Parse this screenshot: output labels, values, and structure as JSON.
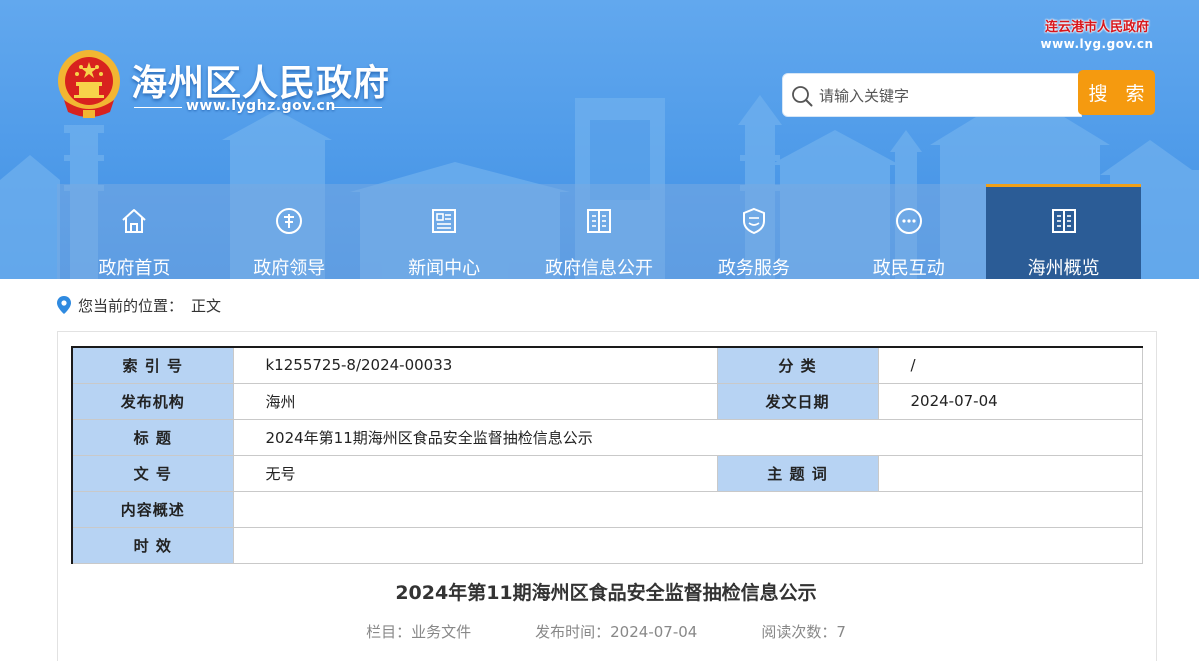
{
  "header": {
    "site_title": "海州区人民政府",
    "site_url": "www.lyghz.gov.cn",
    "city_link": {
      "name": "连云港市人民政府",
      "url": "www.lyg.gov.cn"
    },
    "search": {
      "placeholder": "请输入关键字",
      "button_label": "搜 索"
    },
    "colors": {
      "header_blue": "#4f9be9",
      "search_button": "#f59a0f",
      "nav_active": "#2b5c96",
      "nav_active_top": "#f0a019",
      "city_red": "#d8161b"
    }
  },
  "nav": {
    "items": [
      {
        "label": "政府首页",
        "icon": "home-icon",
        "active": false
      },
      {
        "label": "政府领导",
        "icon": "leader-icon",
        "active": false
      },
      {
        "label": "新闻中心",
        "icon": "news-icon",
        "active": false
      },
      {
        "label": "政府信息公开",
        "icon": "document-icon",
        "active": false
      },
      {
        "label": "政务服务",
        "icon": "shield-icon",
        "active": false
      },
      {
        "label": "政民互动",
        "icon": "chat-bubble-icon",
        "active": false
      },
      {
        "label": "海州概览",
        "icon": "book-icon",
        "active": true
      }
    ]
  },
  "breadcrumb": {
    "prefix": "您当前的位置：",
    "current": "正文"
  },
  "meta": {
    "index_label": "索 引 号",
    "index_value": "k1255725-8/2024-00033",
    "category_label": "分 类",
    "category_value": "/",
    "publisher_label": "发布机构",
    "publisher_value": "海州",
    "date_label": "发文日期",
    "date_value": "2024-07-04",
    "title_label": "标 题",
    "title_value": "2024年第11期海州区食品安全监督抽检信息公示",
    "docno_label": "文 号",
    "docno_value": "无号",
    "keywords_label": "主 题 词",
    "keywords_value": "",
    "summary_label": "内容概述",
    "summary_value": "",
    "validity_label": "时 效",
    "validity_value": ""
  },
  "article": {
    "title": "2024年第11期海州区食品安全监督抽检信息公示",
    "column": "栏目：业务文件",
    "publish_time": "发布时间：2024-07-04",
    "read_count": "阅读次数：7"
  }
}
